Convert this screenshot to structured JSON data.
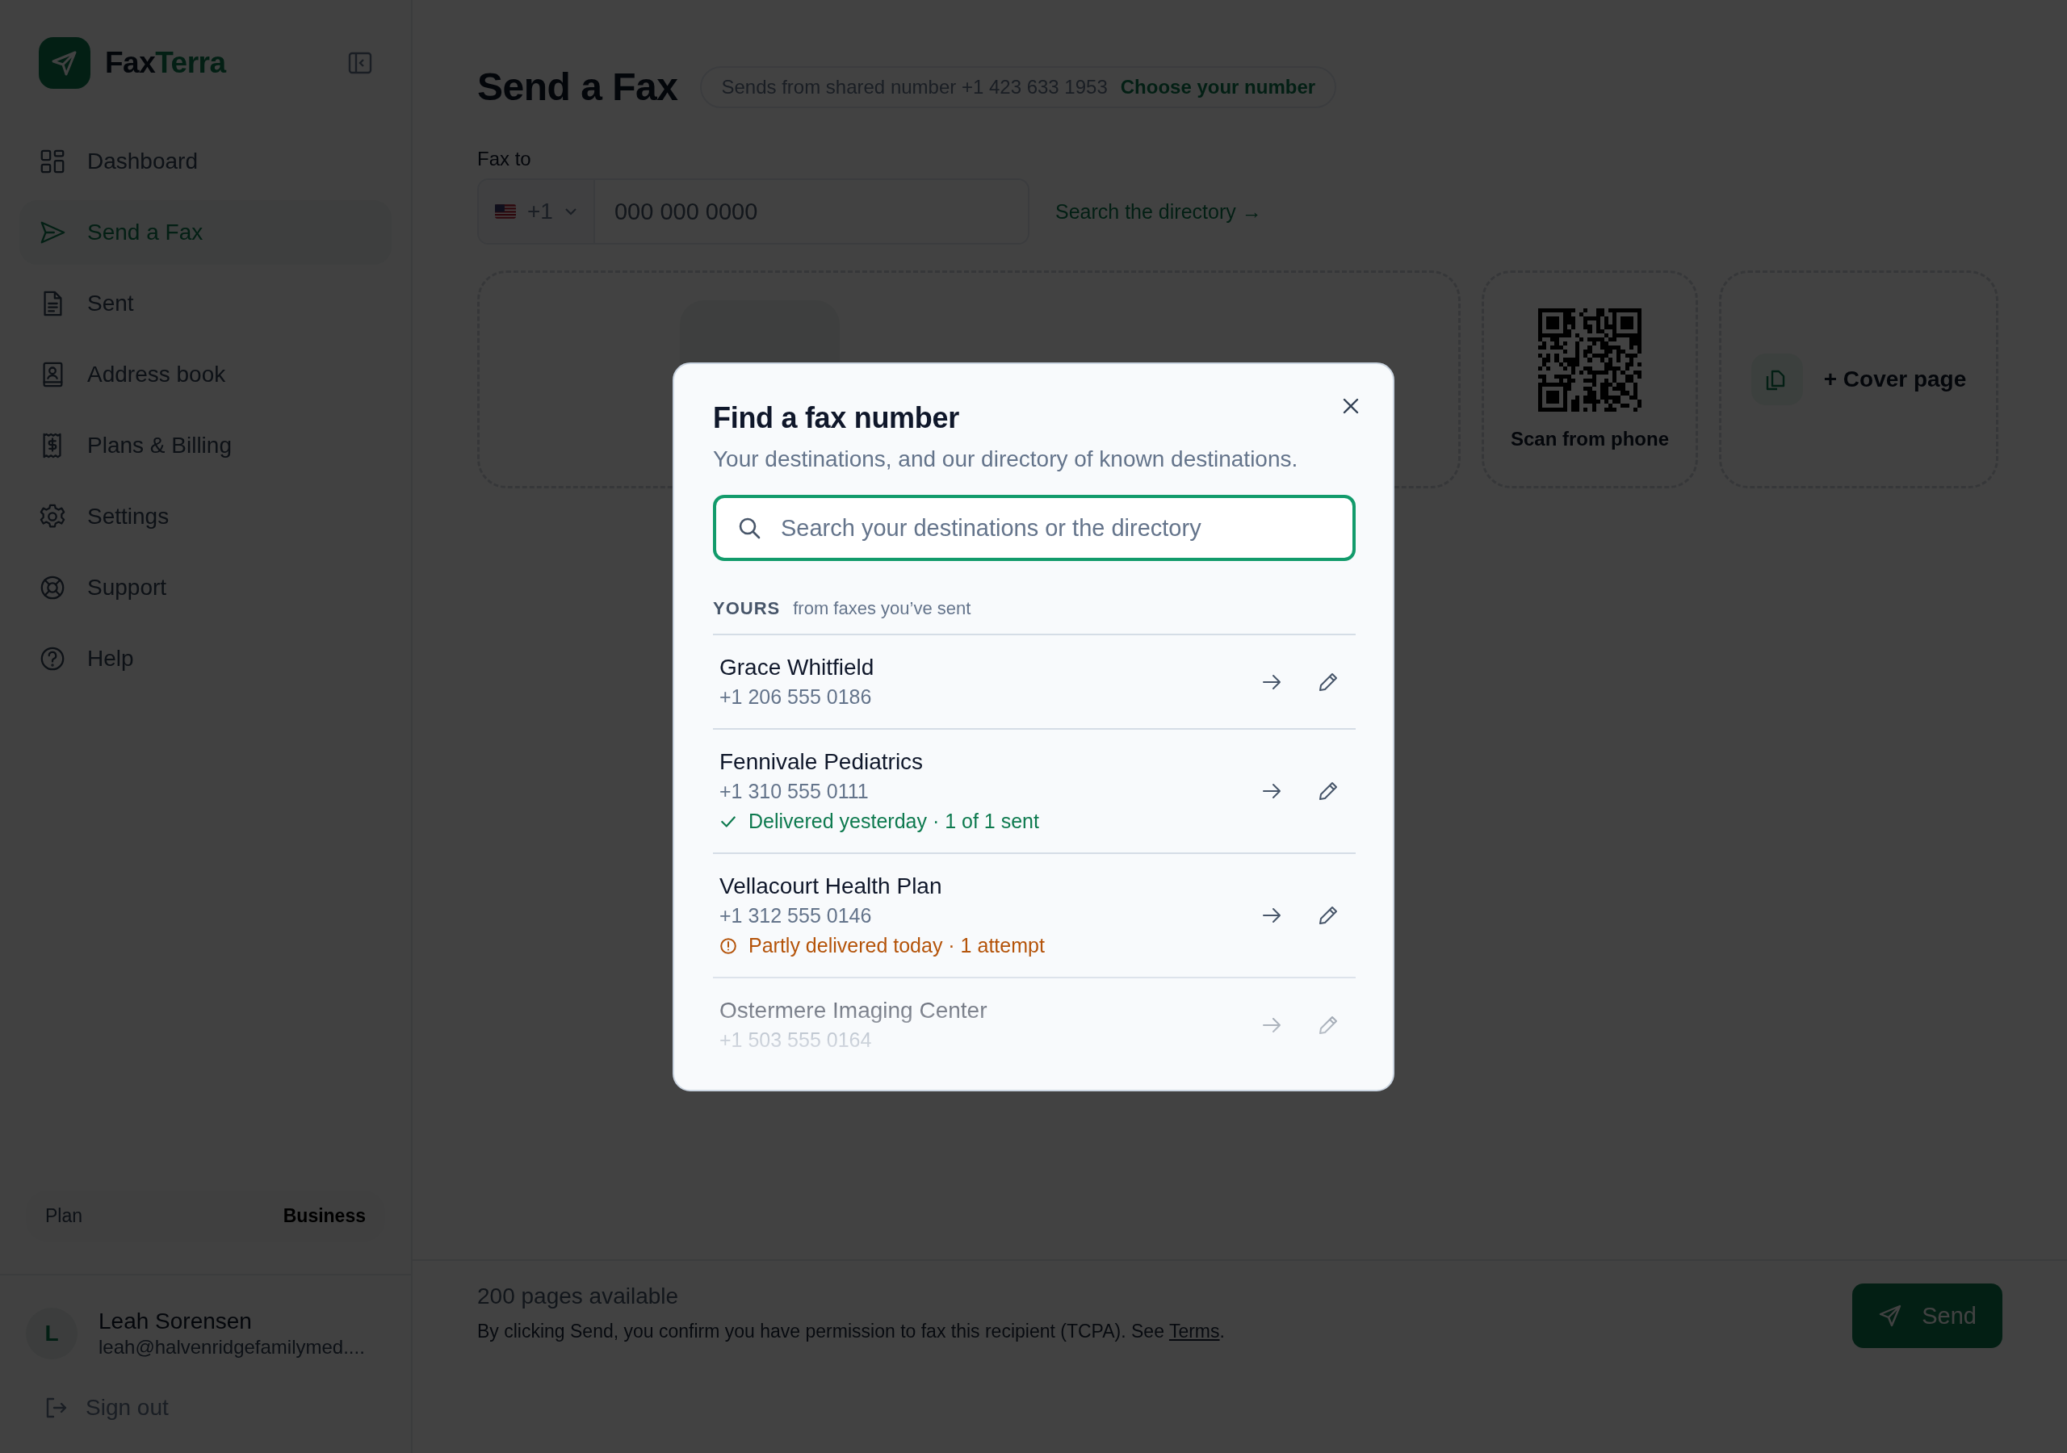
{
  "sidebar": {
    "brand": {
      "part_1": "Fax",
      "part_2": "Terra"
    },
    "items": [
      {
        "label": "Dashboard",
        "selected": false
      },
      {
        "label": "Send a Fax",
        "selected": true
      },
      {
        "label": "Sent",
        "selected": false
      },
      {
        "label": "Address book",
        "selected": false
      },
      {
        "label": "Plans & Billing",
        "selected": false
      },
      {
        "label": "Settings",
        "selected": false
      },
      {
        "label": "Support",
        "selected": false
      },
      {
        "label": "Help",
        "selected": false
      }
    ],
    "plan": {
      "label": "Plan",
      "value": "Business"
    },
    "user": {
      "initial": "L",
      "name": "Leah Sorensen",
      "email": "leah@halvenridgefamilymed...."
    },
    "sign_out": "Sign out"
  },
  "page": {
    "title": "Send a Fax",
    "sender_note": "Sends from shared number +1 423 633 1953",
    "choose_link": "Choose your number",
    "fax_to": {
      "label": "Fax to",
      "country_code": "+1",
      "placeholder": "000 000 0000"
    },
    "directory_link": "Search the directory →",
    "scan_label": "Scan from phone",
    "cover_page": "+ Cover page"
  },
  "footer": {
    "pages": "200 pages available",
    "consent_before": "By clicking Send, you confirm you have permission to fax this recipient (TCPA). See ",
    "terms_link": "Terms",
    "consent_after": ".",
    "send_button": "Send"
  },
  "modal": {
    "title": "Find a fax number",
    "subtitle": "Your destinations, and our directory of known destinations.",
    "search": {
      "placeholder": "Search your destinations or the directory",
      "focused": true
    },
    "section": {
      "label": "YOURS",
      "note": "from faxes you’ve sent"
    },
    "destinations": [
      {
        "name": "Grace Whitfield",
        "number": "+1 206 555 0186"
      },
      {
        "name": "Fennivale Pediatrics",
        "number": "+1 310 555 0111",
        "status": {
          "kind": "delivered",
          "text": "Delivered yesterday · 1 of 1 sent"
        }
      },
      {
        "name": "Vellacourt Health Plan",
        "number": "+1 312 555 0146",
        "status": {
          "kind": "partial",
          "text": "Partly delivered today · 1 attempt"
        }
      },
      {
        "name": "Ostermere Imaging Center",
        "number": "+1 503 555 0164"
      }
    ]
  }
}
